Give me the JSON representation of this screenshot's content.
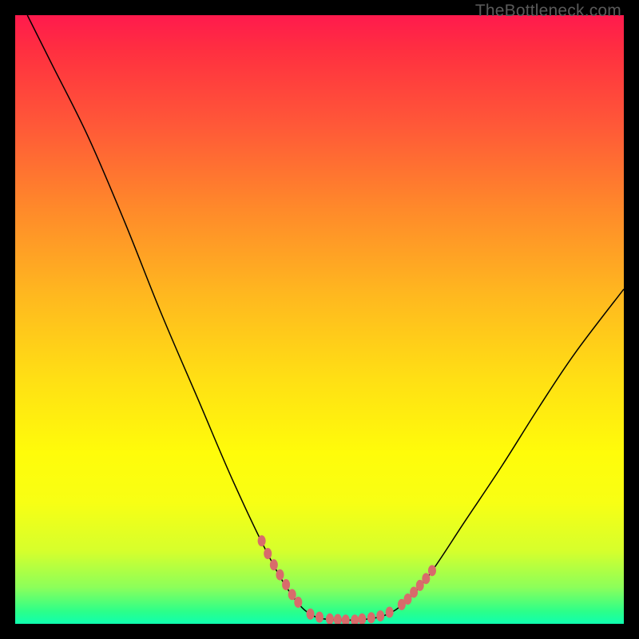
{
  "watermark": "TheBottleneck.com",
  "chart_data": {
    "type": "line",
    "title": "",
    "xlabel": "",
    "ylabel": "",
    "xlim": [
      0,
      100
    ],
    "ylim": [
      0,
      100
    ],
    "series": [
      {
        "name": "curve",
        "style": {
          "stroke": "#000000",
          "width": 1.5
        },
        "points": [
          {
            "x": 2.0,
            "y": 100.0
          },
          {
            "x": 6.0,
            "y": 92.0
          },
          {
            "x": 12.0,
            "y": 80.0
          },
          {
            "x": 18.0,
            "y": 66.0
          },
          {
            "x": 24.0,
            "y": 51.0
          },
          {
            "x": 30.0,
            "y": 37.0
          },
          {
            "x": 36.0,
            "y": 23.0
          },
          {
            "x": 42.0,
            "y": 10.5
          },
          {
            "x": 46.0,
            "y": 4.0
          },
          {
            "x": 49.0,
            "y": 1.3
          },
          {
            "x": 52.0,
            "y": 0.7
          },
          {
            "x": 55.0,
            "y": 0.6
          },
          {
            "x": 58.0,
            "y": 0.8
          },
          {
            "x": 61.0,
            "y": 1.5
          },
          {
            "x": 64.0,
            "y": 3.5
          },
          {
            "x": 68.0,
            "y": 8.0
          },
          {
            "x": 74.0,
            "y": 17.0
          },
          {
            "x": 80.0,
            "y": 26.0
          },
          {
            "x": 86.0,
            "y": 35.5
          },
          {
            "x": 92.0,
            "y": 44.5
          },
          {
            "x": 100.0,
            "y": 55.0
          }
        ]
      }
    ],
    "markers": {
      "style": {
        "fill": "#d86b6b",
        "rx": 5,
        "ry": 7
      },
      "left_band": {
        "x_start": 40.5,
        "x_end": 46.5,
        "count": 7
      },
      "right_band": {
        "x_start": 63.5,
        "x_end": 68.5,
        "count": 6
      },
      "bottom_scatter": [
        {
          "x": 48.5,
          "y": 1.6
        },
        {
          "x": 50.0,
          "y": 1.1
        },
        {
          "x": 51.7,
          "y": 0.8
        },
        {
          "x": 53.0,
          "y": 0.7
        },
        {
          "x": 54.3,
          "y": 0.6
        },
        {
          "x": 55.8,
          "y": 0.6
        },
        {
          "x": 57.0,
          "y": 0.8
        },
        {
          "x": 58.5,
          "y": 1.0
        },
        {
          "x": 60.0,
          "y": 1.3
        },
        {
          "x": 61.5,
          "y": 1.9
        }
      ]
    }
  }
}
